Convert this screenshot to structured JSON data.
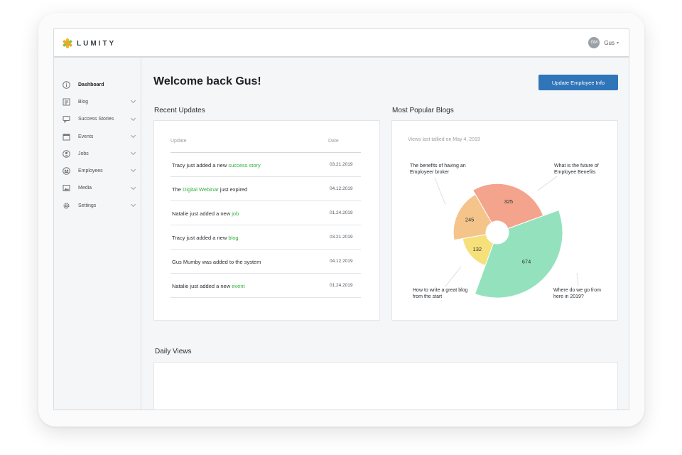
{
  "app": {
    "brand": "LUMITY"
  },
  "user": {
    "initials": "GM",
    "name": "Gus"
  },
  "sidebar": {
    "items": [
      {
        "label": "Dashboard",
        "icon": "info-icon",
        "active": true
      },
      {
        "label": "Blog",
        "icon": "blog-icon"
      },
      {
        "label": "Success Stories",
        "icon": "chat-icon"
      },
      {
        "label": "Events",
        "icon": "calendar-icon"
      },
      {
        "label": "Jobs",
        "icon": "user-icon"
      },
      {
        "label": "Employees",
        "icon": "group-icon"
      },
      {
        "label": "Media",
        "icon": "image-icon"
      },
      {
        "label": "Settings",
        "icon": "gear-icon"
      }
    ]
  },
  "main": {
    "welcome": "Welcome back Gus!",
    "update_button": "Update Employee Info",
    "recent_title": "Recent Updates",
    "popular_title": "Most Popular Blogs",
    "daily_title": "Daily Views"
  },
  "updates": {
    "headers": {
      "update": "Update",
      "date": "Date"
    },
    "rows": [
      {
        "pre": "Tracy just added a new ",
        "link": "success story",
        "post": "",
        "date": "03.21.2019"
      },
      {
        "pre": "The ",
        "link": "Digital Webinar",
        "post": " just expired",
        "date": "04.12.2019"
      },
      {
        "pre": "Natalie just added a new ",
        "link": "job",
        "post": "",
        "date": "01.24.2019"
      },
      {
        "pre": "Tracy just added a new ",
        "link": "blog",
        "post": "",
        "date": "03.21.2019"
      },
      {
        "pre": "Gus Mumby was added to the system",
        "link": "",
        "post": "",
        "date": "04.12.2019"
      },
      {
        "pre": "Natalie just added a new ",
        "link": "event",
        "post": "",
        "date": "01.24.2019"
      }
    ]
  },
  "popular": {
    "note": "Views last tallied on May 4, 2019",
    "labels": {
      "broker": "The benefits of having an\nEmployeer broker",
      "future": "What is the future of\nEmployee Benefits",
      "blog": "How to write a great blog\nfrom the start",
      "where": "Where do we go from\nhere in 2019?"
    }
  },
  "colors": {
    "accent": "#2f75b8",
    "link": "#2fae3c"
  },
  "chart_data": {
    "type": "pie",
    "subtitle": "Views last tallied on May 4, 2019",
    "categories": [
      "What is the future of Employee Benefits",
      "Where do we go from here in 2019?",
      "How to write a great blog from the start",
      "The benefits of having an Employeer broker"
    ],
    "values": [
      325,
      674,
      132,
      245
    ],
    "colors": [
      "#f4a48c",
      "#94e2bd",
      "#f6e07a",
      "#f4c48a"
    ]
  }
}
